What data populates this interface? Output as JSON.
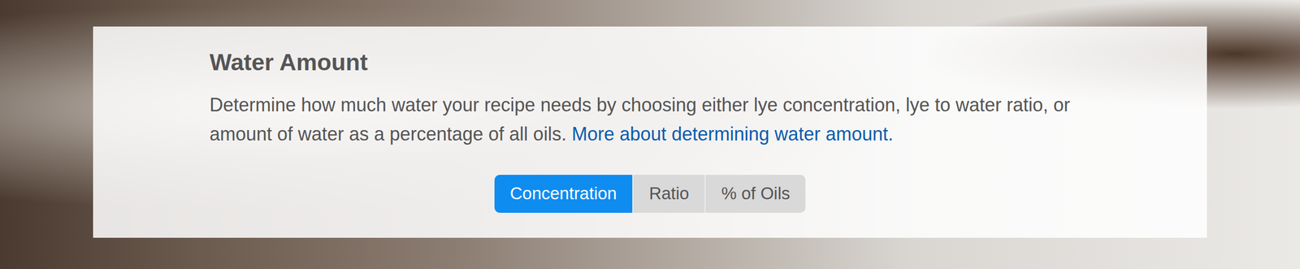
{
  "section": {
    "title": "Water Amount",
    "description": "Determine how much water your recipe needs by choosing either lye concentration, lye to water ratio, or amount of water as a percentage of all oils.",
    "link": "More about determining water amount."
  },
  "tabs": [
    {
      "label": "Concentration",
      "selected": true
    },
    {
      "label": "Ratio",
      "selected": false
    },
    {
      "label": "% of Oils",
      "selected": false
    }
  ]
}
